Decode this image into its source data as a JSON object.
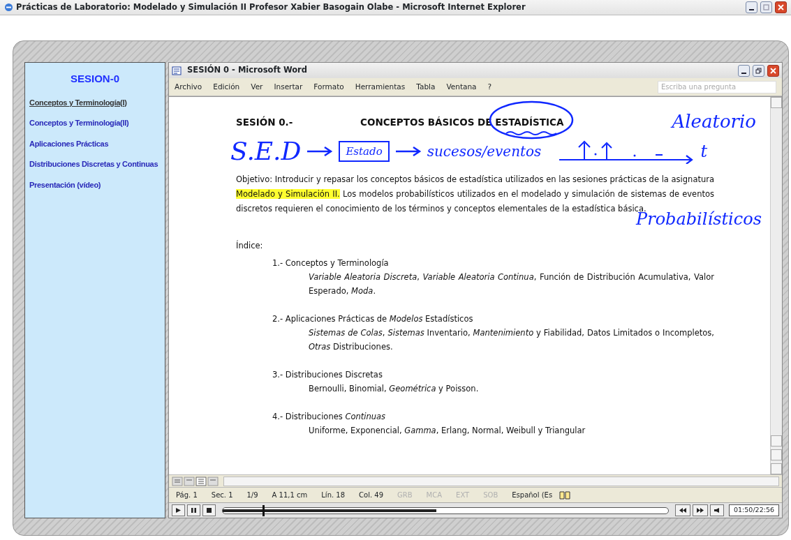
{
  "window": {
    "title": "Prácticas de Laboratorio: Modelado y Simulación II Profesor Xabier Basogain Olabe - Microsoft Internet Explorer"
  },
  "sidebar": {
    "heading": "SESION-0",
    "items": [
      {
        "label": "Conceptos y Terminología(I)",
        "selected": true
      },
      {
        "label": "Conceptos y Terminología(II)",
        "selected": false
      },
      {
        "label": "Aplicaciones Prácticas",
        "selected": false
      },
      {
        "label": "Distribuciones Discretas y Continuas",
        "selected": false
      },
      {
        "label": "Presentación (vídeo)",
        "selected": false
      }
    ]
  },
  "word": {
    "title": "SESIÓN 0 - Microsoft Word",
    "menu": [
      "Archivo",
      "Edición",
      "Ver",
      "Insertar",
      "Formato",
      "Herramientas",
      "Tabla",
      "Ventana",
      "?"
    ],
    "ask": {
      "placeholder": "Escriba una pregunta"
    },
    "document": {
      "heading_left": "SESIÓN 0.-",
      "heading_right": "CONCEPTOS BÁSICOS DE ESTADÍSTICA",
      "handwriting": {
        "top_note": "Aleatorio",
        "line": [
          "S.E.D",
          "Estado",
          "sucesos/eventos"
        ],
        "axis_label": "t",
        "side_note": "Probabilísticos"
      },
      "objective": [
        {
          "text": "Objetivo:  Introducir y repasar los conceptos básicos de estadística utilizados en las sesiones prácticas de la asignatura ",
          "highlighted": false
        },
        {
          "text": "Modelado y Simulación II.",
          "highlighted": true
        },
        {
          "text": " Los modelos probabilísticos utilizados en el modelado y simulación de sistemas de eventos discretos requieren el conocimiento de los términos y conceptos elementales de la estadística básica.",
          "highlighted": false
        }
      ],
      "index_title": "Índice:",
      "sections": [
        {
          "title": "1.- Conceptos y Terminología",
          "description": "*Variable Aleatoria Discreta*, *Variable Aleatoria Continua*, Función de Distribución Acumulativa, Valor Esperado, *Moda*."
        },
        {
          "title": "2.- Aplicaciones Prácticas de *Modelos* Estadísticos",
          "description": "*Sistemas de Colas*, *Sistemas* Inventario, *Mantenimiento* y Fiabilidad, Datos Limitados o Incompletos, *Otras* Distribuciones."
        },
        {
          "title": "3.- Distribuciones Discretas",
          "description": "Bernoulli, Binomial, *Geométrica* y Poisson."
        },
        {
          "title": "4.- Distribuciones *Continuas*",
          "description": "Uniforme, Exponencial, *Gamma*, Erlang, Normal, Weibull y Triangular"
        }
      ]
    },
    "status_bar": {
      "fields": [
        "Pág. 1",
        "Sec. 1",
        "1/9",
        "A 11,1 cm",
        "Lín. 18",
        "Col. 49"
      ],
      "modes": [
        {
          "label": "GRB",
          "on": false
        },
        {
          "label": "MCA",
          "on": false
        },
        {
          "label": "EXT",
          "on": false
        },
        {
          "label": "SOB",
          "on": false
        }
      ],
      "language": "Español (Es"
    }
  },
  "player": {
    "seek": {
      "level": 0.09
    },
    "buffer": {
      "level": 0.48
    },
    "time": "01:50/22:56"
  }
}
